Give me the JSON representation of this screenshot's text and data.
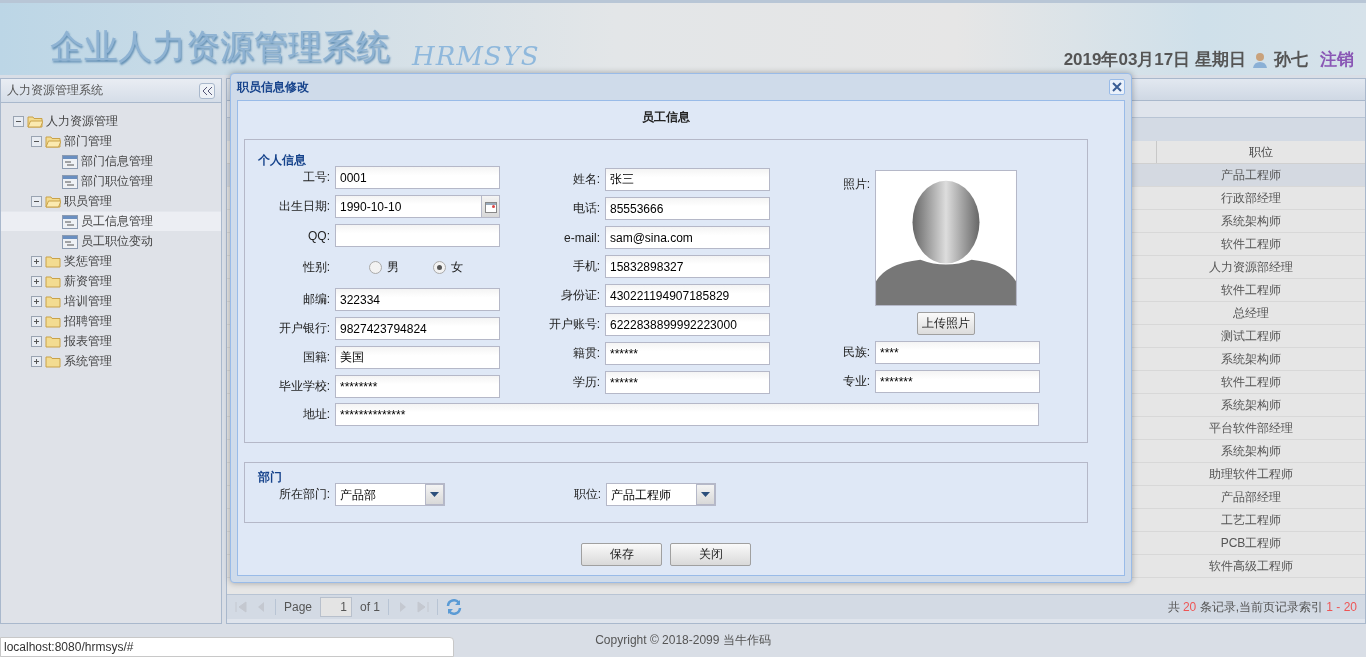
{
  "header": {
    "title": "企业人力资源管理系统",
    "logo": "HRMSYS",
    "date": "2019年03月17日 星期日",
    "user": "孙七",
    "logout": "注销"
  },
  "sidebar": {
    "title": "人力资源管理系统",
    "tree": [
      {
        "label": "人力资源管理",
        "kind": "folder",
        "expanded": true,
        "selected": false,
        "children": [
          {
            "label": "部门管理",
            "kind": "folder",
            "expanded": true,
            "selected": false,
            "children": [
              {
                "label": "部门信息管理",
                "kind": "leaf",
                "selected": false
              },
              {
                "label": "部门职位管理",
                "kind": "leaf",
                "selected": false
              }
            ]
          },
          {
            "label": "职员管理",
            "kind": "folder",
            "expanded": true,
            "selected": false,
            "children": [
              {
                "label": "员工信息管理",
                "kind": "leaf",
                "selected": true
              },
              {
                "label": "员工职位变动",
                "kind": "leaf",
                "selected": false
              }
            ]
          },
          {
            "label": "奖惩管理",
            "kind": "folder",
            "expanded": false,
            "selected": false
          },
          {
            "label": "薪资管理",
            "kind": "folder",
            "expanded": false,
            "selected": false
          },
          {
            "label": "培训管理",
            "kind": "folder",
            "expanded": false,
            "selected": false
          },
          {
            "label": "招聘管理",
            "kind": "folder",
            "expanded": false,
            "selected": false
          },
          {
            "label": "报表管理",
            "kind": "folder",
            "expanded": false,
            "selected": false
          },
          {
            "label": "系统管理",
            "kind": "folder",
            "expanded": false,
            "selected": false
          }
        ]
      }
    ]
  },
  "grid": {
    "column": "职位",
    "rows": [
      {
        "position": "产品工程师",
        "selected": true
      },
      {
        "position": "行政部经理",
        "selected": false
      },
      {
        "position": "系统架构师",
        "selected": false
      },
      {
        "position": "软件工程师",
        "selected": false
      },
      {
        "position": "人力资源部经理",
        "selected": false
      },
      {
        "position": "软件工程师",
        "selected": false
      },
      {
        "position": "总经理",
        "selected": false
      },
      {
        "position": "测试工程师",
        "selected": false
      },
      {
        "position": "系统架构师",
        "selected": false
      },
      {
        "position": "软件工程师",
        "selected": false
      },
      {
        "position": "系统架构师",
        "selected": false
      },
      {
        "position": "平台软件部经理",
        "selected": false
      },
      {
        "position": "系统架构师",
        "selected": false
      },
      {
        "position": "助理软件工程师",
        "selected": false
      },
      {
        "position": "产品部经理",
        "selected": false
      },
      {
        "position": "工艺工程师",
        "selected": false
      },
      {
        "position": "PCB工程师",
        "selected": false
      },
      {
        "position": "软件高级工程师",
        "selected": false
      }
    ],
    "pager": {
      "page_label": "Page",
      "page": "1",
      "of": "of 1",
      "summary": {
        "prefix": "共",
        "total": "20",
        "middle": "条记录,当前页记录索引",
        "range": "1 - 20"
      }
    }
  },
  "dialog": {
    "title": "职员信息修改",
    "heading": "员工信息",
    "personal": {
      "legend": "个人信息",
      "columns": [
        [
          {
            "kind": "text",
            "label": "工号:",
            "value": "0001"
          },
          {
            "kind": "date",
            "label": "出生日期:",
            "value": "1990-10-10"
          },
          {
            "kind": "text",
            "label": "QQ:"
          },
          {
            "kind": "radio",
            "label": "性别:",
            "options": [
              {
                "label": "男",
                "selected": false
              },
              {
                "label": "女",
                "selected": true
              }
            ]
          },
          {
            "kind": "text",
            "label": "邮编:",
            "value": "322334"
          },
          {
            "kind": "text",
            "label": "开户银行:",
            "value": "9827423794824"
          },
          {
            "kind": "text",
            "label": "国籍:",
            "value": "美国"
          },
          {
            "kind": "text",
            "label": "毕业学校:",
            "value": "********"
          }
        ],
        [
          {
            "kind": "text",
            "label": "姓名:",
            "value": "张三"
          },
          {
            "kind": "text",
            "label": "电话:",
            "value": "85553666"
          },
          {
            "kind": "text",
            "label": "e-mail:",
            "value": "sam@sina.com"
          },
          {
            "kind": "text",
            "label": "手机:",
            "value": "15832898327"
          },
          {
            "kind": "text",
            "label": "身份证:",
            "value": "430221194907185829"
          },
          {
            "kind": "text",
            "label": "开户账号:",
            "value": "6222838899992223000"
          },
          {
            "kind": "text",
            "label": "籍贯:",
            "value": "******"
          },
          {
            "kind": "text",
            "label": "学历:",
            "value": "******"
          }
        ],
        [
          {
            "kind": "photo",
            "label": "照片:",
            "button": "上传照片"
          },
          {
            "kind": "text",
            "label": "民族:",
            "value": "****"
          },
          {
            "kind": "text",
            "label": "专业:",
            "value": "*******"
          }
        ]
      ],
      "address": {
        "label": "地址:",
        "value": "**************"
      }
    },
    "department": {
      "legend": "部门",
      "fields": [
        {
          "kind": "select",
          "label": "所在部门:",
          "value": "产品部"
        },
        {
          "kind": "select",
          "label": "职位:",
          "value": "产品工程师"
        }
      ]
    },
    "buttons": [
      "保存",
      "关闭"
    ]
  },
  "footer": {
    "copyright": "Copyright © 2018-2099 当牛作码"
  },
  "status": {
    "url": "localhost:8080/hrmsys/#"
  }
}
